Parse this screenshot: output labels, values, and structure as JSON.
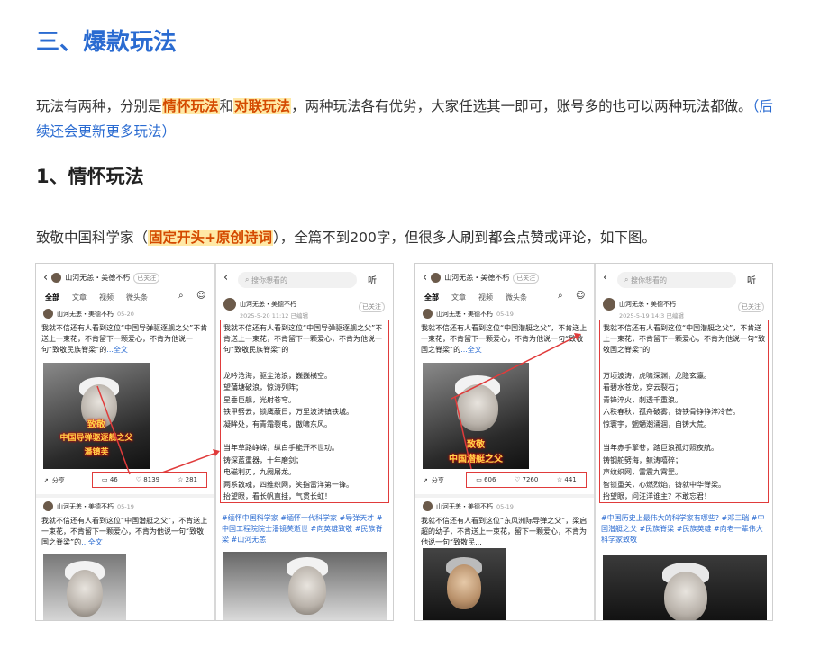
{
  "heading": "三、爆款玩法",
  "intro": {
    "a": "玩法有两种，分别是",
    "hl1": "情怀玩法",
    "and": "和",
    "hl2": "对联玩法",
    "b": "，两种玩法各有优劣，大家任选其一即可，账号多的也可以两种玩法都做。",
    "note": "（后续还会更新更多玩法）"
  },
  "sub_heading": "1、情怀玩法",
  "desc": {
    "a": "致敬中国科学家（",
    "hl": "固定开头+原创诗词",
    "b": "），全篇不到200字，但很多人刷到都会点赞或评论，如下图。"
  },
  "shots": [
    {
      "left": {
        "user": "山河无恙・美德不朽",
        "follow": "已关注",
        "tabs": [
          "全部",
          "文章",
          "视频",
          "微头条"
        ],
        "author": "山河无恙・美德不朽",
        "time": "05-20",
        "text": "我就不信还有人看到这位“中国导弹驱逐舰之父”不肯送上一束花，不肯留下一颗爱心，不肯为他说一句“致敬民族脊梁”的",
        "more": "...全文",
        "caption1": "致敬",
        "caption2": "中国导弹驱逐舰之父",
        "caption3": "潘镜芙",
        "share": "分享",
        "comments": "46",
        "likes": "8139",
        "stars": "281",
        "author2": "山河无恙・美德不朽",
        "time2": "05-19",
        "text2": "我就不信还有人看到这位“中国潜艇之父”，不肯送上一束花，不肯留下一颗爱心，不肯为他说一句“致敬国之脊梁”的",
        "more2": "...全文"
      },
      "right": {
        "search": "搜你想看的",
        "listen": "听",
        "author": "山河无恙・美德不朽",
        "follow": "已关注",
        "time": "2025-5-20 11:12 已编辑",
        "text": "我就不信还有人看到这位“中国导弹驱逐舰之父”不肯送上一束花，不肯留下一颗爱心，不肯为他说一句“致敬民族脊梁”的",
        "poem": [
          "龙吟沧海，驱尘沧浪，巍巍横空。",
          "望蒲塘破浪，惊涛列阵；",
          "星垂巨舰，光射苍穹。",
          "铁甲劈云，锁鹰蔽日，万里波涛镇铁城。",
          "凝眸处，有青霜裂电，傲啸东风。",
          "",
          "当年草路峥嵘，纵白手能开不世功。",
          "铸深蓝重器，十年磨剑；",
          "电磁利刃，九阙屠龙。",
          "两系散魂，四维织网，笑指雷洋第一锋。",
          "抬望眼，看长帆直挂，气贯长虹！"
        ],
        "tags": "#缅怀中国科学家 #缅怀一代科学家 #导弹天才 #中国工程院院士潘镜芙逝世 #向英雄致敬 #民族脊梁 #山河无恙"
      }
    },
    {
      "left": {
        "user": "山河无恙・美德不朽",
        "follow": "已关注",
        "tabs": [
          "全部",
          "文章",
          "视频",
          "微头条"
        ],
        "author": "山河无恙・美德不朽",
        "time": "05-19",
        "text": "我就不信还有人看到这位“中国潜艇之父”，不肯送上一束花，不肯留下一颗爱心，不肯为他说一句“致敬国之脊梁”的",
        "more": "...全文",
        "caption1": "致敬",
        "caption2": "中国潜艇之父",
        "caption3": "",
        "share": "分享",
        "comments": "606",
        "likes": "7260",
        "stars": "441",
        "author2": "山河无恙・美德不朽",
        "time2": "05-19",
        "text2": "我就不信还有人看到这位“东风洲际导弹之父”，梁启超的幼子，不肯送上一束花，留下一颗爱心，不肯为他说一句“致敬民...",
        "more2": ""
      },
      "right": {
        "search": "搜你想看的",
        "listen": "听",
        "author": "山河无恙・美德不朽",
        "follow": "已关注",
        "time": "2025-5-19 14:3 已编辑",
        "text": "我就不信还有人看到这位“中国潜艇之父”，不肯送上一束花，不肯留下一颗爱心，不肯为他说一句“致敬国之脊梁”的",
        "poem": [
          "万顷波涛，虎啸深渊，龙隐玄瀛。",
          "看碧水苍龙，穿云裂石；",
          "青锋淬火，刺透千重浪。",
          "六秩春秋，孤舟破雾，铸铁骨铮铮淬冷芒。",
          "惊寰宇，魍魉潮涌涸，自铸大荒。",
          "",
          "当年赤手擎苍，踏巨浪孤灯照夜航。",
          "铸钢舵劈海，鲸涛嘻碎；",
          "声纹织网，雷震九霄罡。",
          "智锁重关，心燃烈焰，铸就中华脊梁。",
          "抬望眼，问汪洋谁主？不敢忘君！"
        ],
        "tags": "#中国历史上最伟大的科学家有哪些? #邓三瑞 #中国潜艇之父 #民族脊梁 #民族英雄 #向老一辈伟大科学家致敬"
      }
    }
  ]
}
